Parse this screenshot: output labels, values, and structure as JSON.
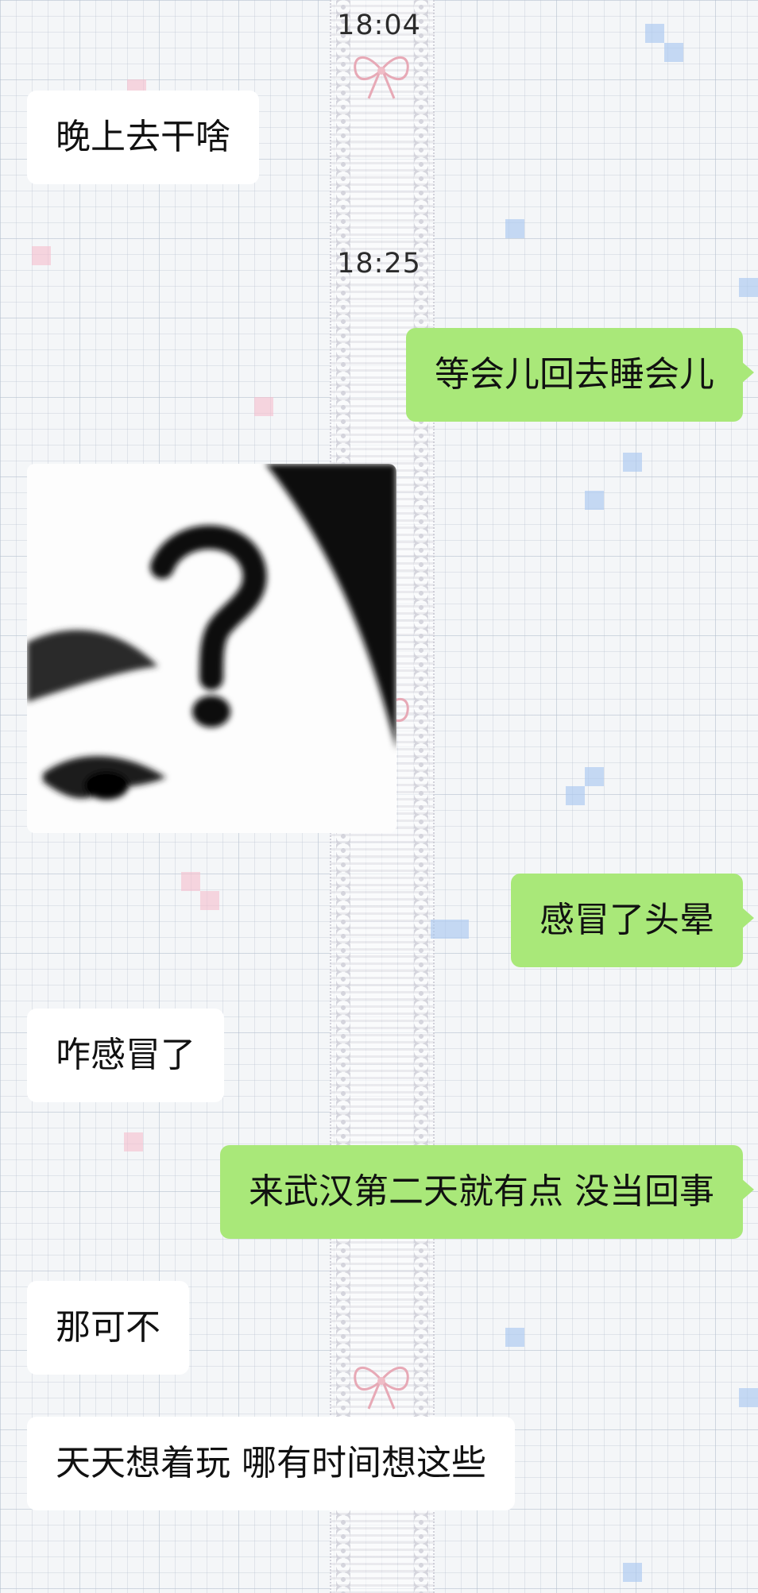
{
  "messages": [
    {
      "type": "time",
      "text": "18:04"
    },
    {
      "type": "text",
      "side": "left",
      "text": "晚上去干啥"
    },
    {
      "type": "time",
      "text": "18:25"
    },
    {
      "type": "text",
      "side": "right",
      "text": "等会儿回去睡会儿"
    },
    {
      "type": "sticker",
      "side": "left",
      "icon": "question-mark-face-sticker"
    },
    {
      "type": "text",
      "side": "right",
      "text": "感冒了头晕"
    },
    {
      "type": "text",
      "side": "left",
      "text": "咋感冒了"
    },
    {
      "type": "text",
      "side": "right",
      "text": "来武汉第二天就有点 没当回事"
    },
    {
      "type": "text",
      "side": "left",
      "text": "那可不"
    },
    {
      "type": "text",
      "side": "left",
      "text": "天天想着玩 哪有时间想这些"
    }
  ],
  "colors": {
    "sent_bubble": "#a9e879",
    "received_bubble": "#ffffff",
    "background": "#f4f6f8"
  }
}
